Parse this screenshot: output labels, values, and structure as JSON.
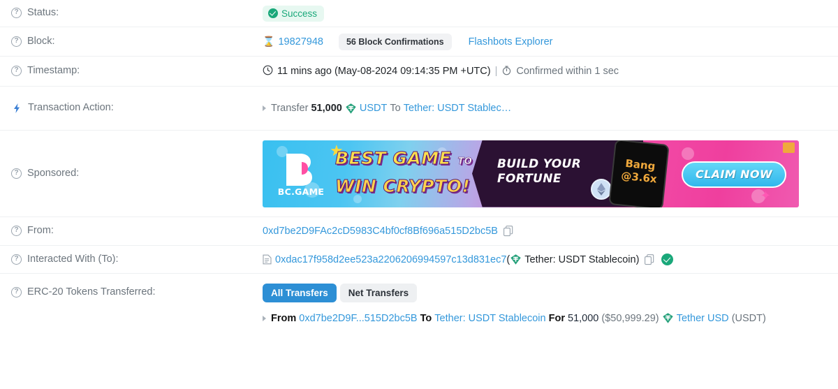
{
  "rows": {
    "status": {
      "label": "Status:",
      "badge": "Success",
      "help_icon": "question-circle-icon"
    },
    "block": {
      "label": "Block:",
      "icon": "hourglass-icon",
      "number": "19827948",
      "confirmations": "56 Block Confirmations",
      "explorer_link": "Flashbots Explorer"
    },
    "timestamp": {
      "label": "Timestamp:",
      "clock_icon": "clock-icon",
      "ago": "11 mins ago",
      "absolute": "(May-08-2024 09:14:35 PM +UTC)",
      "separator": "|",
      "stopwatch_icon": "stopwatch-icon",
      "confirmed": "Confirmed within 1 sec"
    },
    "action": {
      "label": "Transaction Action:",
      "icon": "lightning-bolt-icon",
      "verb": "Transfer",
      "amount": "51,000",
      "token_icon": "usdt-token-icon",
      "token": "USDT",
      "to_word": "To",
      "recipient": "Tether: USDT Stablec…"
    },
    "sponsored": {
      "label": "Sponsored:",
      "banner": {
        "brand": "BC.GAME",
        "headline_1": "BEST GAME",
        "headline_to": "TO",
        "headline_2": "WIN CRYPTO!",
        "tagline_1": "BUILD YOUR",
        "tagline_2": "FORTUNE",
        "multiplier_1": "Bang",
        "multiplier_2": "@3.6x",
        "cta": "CLAIM NOW"
      }
    },
    "from": {
      "label": "From:",
      "address": "0xd7be2D9FAc2cD5983C4bf0cf8Bf696a515D2bc5B",
      "copy_icon": "copy-icon"
    },
    "to": {
      "label": "Interacted With (To):",
      "doc_icon": "contract-document-icon",
      "address": "0xdac17f958d2ee523a2206206994597c13d831ec7",
      "open_paren": "(",
      "token_icon": "usdt-token-icon",
      "name": "Tether: USDT Stablecoin",
      "close_paren": ")",
      "copy_icon": "copy-icon",
      "verified_icon": "verified-check-icon"
    },
    "erc20": {
      "label": "ERC-20 Tokens Transferred:",
      "tabs": [
        {
          "label": "All Transfers",
          "active": true
        },
        {
          "label": "Net Transfers",
          "active": false
        }
      ],
      "transfer": {
        "from_word": "From",
        "from_address": "0xd7be2D9F...515D2bc5B",
        "to_word": "To",
        "to_name": "Tether: USDT Stablecoin",
        "for_word": "For",
        "amount": "51,000",
        "usd_value": "($50,999.29)",
        "token_icon": "usdt-token-icon",
        "token_name": "Tether USD",
        "token_symbol": "(USDT)"
      }
    }
  },
  "colors": {
    "link": "#3498db",
    "success": "#1aa87a",
    "success_bg": "#e7f8f1",
    "tab_active": "#2d8fd5",
    "label_gray": "#6c757d",
    "usdt_teal": "#26a17b"
  }
}
